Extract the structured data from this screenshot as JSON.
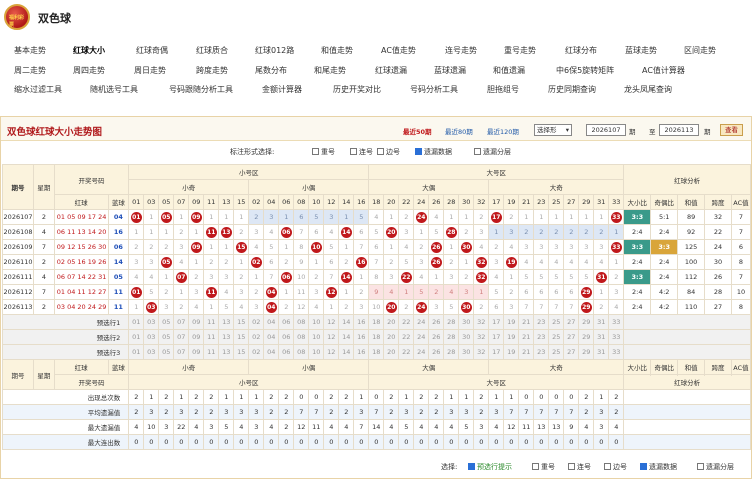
{
  "app": {
    "title": "双色球",
    "logo_text": "福利彩票"
  },
  "nav": [
    [
      "基本走势",
      "红球大小",
      "红球奇偶",
      "红球质合",
      "红球012路",
      "和值走势",
      "AC值走势",
      "连号走势",
      "重号走势",
      "红球分布",
      "蓝球走势",
      "区间走势"
    ],
    [
      "周二走势",
      "周四走势",
      "周日走势",
      "跨度走势",
      "尾数分布",
      "和尾走势",
      "红球遗漏",
      "蓝球遗漏",
      "和值遗漏",
      "中6保5旋转矩阵",
      "AC值计算器"
    ],
    [
      "缩水过滤工具",
      "随机选号工具",
      "号码跟随分析工具",
      "金额计算器",
      "历史开奖对比",
      "号码分析工具",
      "胆拖组号",
      "历史同期查询",
      "龙头凤尾查询"
    ]
  ],
  "nav_active": "红球大小",
  "panel": {
    "title": "双色球红球大小走势图",
    "p50": "最近50期",
    "p80": "最近80期",
    "p120": "最近120期",
    "select": "选择形",
    "from": "2026107",
    "to": "2026113",
    "lbl_qi": "期",
    "lbl_to": "至",
    "lbl_qi2": "期",
    "btn": "查看"
  },
  "options": {
    "label": "标注形式选择:",
    "items": [
      "重号",
      "连号",
      "边号",
      "遗漏数据",
      "遗漏分层"
    ]
  },
  "header": {
    "qihao": "期号",
    "xingqi": "星期",
    "kjhm": "开奖号码",
    "hongqiu": "红球",
    "lanqiu": "蓝球",
    "small_zone": "小号区",
    "big_zone": "大号区",
    "xiaoqi": "小奇",
    "xiaoou": "小偶",
    "daou": "大偶",
    "daqi": "大奇",
    "analysis": "红球分析",
    "dxb": "大小比",
    "job": "奇偶比",
    "hz": "和值",
    "kd": "跨度",
    "ac": "AC值"
  },
  "cols": [
    "01",
    "03",
    "05",
    "07",
    "09",
    "11",
    "13",
    "15",
    "02",
    "04",
    "06",
    "08",
    "10",
    "12",
    "14",
    "16",
    "18",
    "20",
    "22",
    "24",
    "26",
    "28",
    "30",
    "32",
    "17",
    "19",
    "21",
    "23",
    "25",
    "27",
    "29",
    "31",
    "33"
  ],
  "rows": [
    {
      "p": "2026107",
      "w": "2",
      "r": "01 05 09 17 24 33",
      "b": "04",
      "c": [
        "●",
        "1",
        "●",
        "1",
        "●",
        "1",
        "1",
        "1",
        "2",
        "3",
        "1",
        "6",
        "5",
        "3",
        "1",
        "5",
        "4",
        "1",
        "2",
        "●",
        "4",
        "1",
        "1",
        "2",
        "●",
        "2",
        "1",
        "1",
        "1",
        "1",
        "1",
        "1",
        "●"
      ],
      "dx": "3:3",
      "jo": "5:1",
      "hz": "89",
      "kd": "32",
      "ac": "7"
    },
    {
      "p": "2026108",
      "w": "4",
      "r": "06 11 13 14 20 28",
      "b": "16",
      "c": [
        "1",
        "1",
        "1",
        "2",
        "1",
        "●",
        "●",
        "2",
        "3",
        "4",
        "●",
        "7",
        "6",
        "4",
        "●",
        "6",
        "5",
        "●",
        "3",
        "1",
        "5",
        "●",
        "2",
        "3",
        "1",
        "3",
        "2",
        "2",
        "2",
        "2",
        "2",
        "2",
        "1"
      ],
      "dx": "2:4",
      "jo": "2:4",
      "hz": "92",
      "kd": "22",
      "ac": "7"
    },
    {
      "p": "2026109",
      "w": "7",
      "r": "09 12 15 26 30 33",
      "b": "06",
      "c": [
        "2",
        "2",
        "2",
        "3",
        "●",
        "1",
        "1",
        "●",
        "4",
        "5",
        "1",
        "8",
        "●",
        "5",
        "1",
        "7",
        "6",
        "1",
        "4",
        "2",
        "●",
        "1",
        "●",
        "4",
        "2",
        "4",
        "3",
        "3",
        "3",
        "3",
        "3",
        "3",
        "●"
      ],
      "dx": "3:3",
      "jo": "3:3",
      "hz": "125",
      "kd": "24",
      "ac": "6"
    },
    {
      "p": "2026110",
      "w": "2",
      "r": "02 05 16 19 26 32",
      "b": "14",
      "c": [
        "3",
        "3",
        "●",
        "4",
        "1",
        "2",
        "2",
        "1",
        "●",
        "6",
        "2",
        "9",
        "1",
        "6",
        "2",
        "●",
        "7",
        "2",
        "5",
        "3",
        "●",
        "2",
        "1",
        "●",
        "3",
        "●",
        "4",
        "4",
        "4",
        "4",
        "4",
        "4",
        "1"
      ],
      "dx": "2:4",
      "jo": "2:4",
      "hz": "100",
      "kd": "30",
      "ac": "8"
    },
    {
      "p": "2026111",
      "w": "4",
      "r": "06 07 14 22 31 32",
      "b": "05",
      "c": [
        "4",
        "4",
        "1",
        "●",
        "2",
        "3",
        "3",
        "2",
        "1",
        "7",
        "●",
        "10",
        "2",
        "7",
        "●",
        "1",
        "8",
        "3",
        "●",
        "4",
        "1",
        "3",
        "2",
        "●",
        "4",
        "1",
        "5",
        "5",
        "5",
        "5",
        "5",
        "●",
        "2"
      ],
      "dx": "3:3",
      "jo": "2:4",
      "hz": "112",
      "kd": "26",
      "ac": "7"
    },
    {
      "p": "2026112",
      "w": "7",
      "r": "01 04 11 12 27 29",
      "b": "11",
      "c": [
        "●",
        "5",
        "2",
        "1",
        "3",
        "●",
        "4",
        "3",
        "2",
        "●",
        "1",
        "11",
        "3",
        "●",
        "1",
        "2",
        "9",
        "4",
        "1",
        "5",
        "2",
        "4",
        "3",
        "1",
        "5",
        "2",
        "6",
        "6",
        "6",
        "6",
        "●",
        "1",
        "3"
      ],
      "dx": "2:4",
      "jo": "4:2",
      "hz": "84",
      "kd": "28",
      "ac": "10"
    },
    {
      "p": "2026113",
      "w": "2",
      "r": "03 04 20 24 29 30",
      "b": "11",
      "c": [
        "1",
        "●",
        "3",
        "2",
        "4",
        "1",
        "5",
        "4",
        "3",
        "●",
        "2",
        "12",
        "4",
        "1",
        "2",
        "3",
        "10",
        "●",
        "2",
        "●",
        "3",
        "5",
        "●",
        "2",
        "6",
        "3",
        "7",
        "7",
        "7",
        "7",
        "●",
        "2",
        "4"
      ],
      "dx": "2:4",
      "jo": "4:2",
      "hz": "110",
      "kd": "27",
      "ac": "8"
    }
  ],
  "prelabels": [
    "预选行1",
    "预选行2",
    "预选行3"
  ],
  "footer_hdr": {
    "qihao": "期号",
    "xingqi": "星期",
    "kjhm": "开奖号码"
  },
  "stats": [
    {
      "label": "出现总次数",
      "v": [
        "2",
        "1",
        "2",
        "1",
        "2",
        "2",
        "1",
        "1",
        "1",
        "2",
        "2",
        "0",
        "0",
        "2",
        "2",
        "1",
        "0",
        "2",
        "1",
        "2",
        "2",
        "1",
        "1",
        "2",
        "1",
        "1",
        "0",
        "0",
        "0",
        "0",
        "2",
        "1",
        "2"
      ]
    },
    {
      "label": "平均遗漏值",
      "v": [
        "2",
        "3",
        "2",
        "3",
        "2",
        "2",
        "3",
        "3",
        "3",
        "2",
        "2",
        "7",
        "7",
        "2",
        "2",
        "3",
        "7",
        "2",
        "3",
        "2",
        "2",
        "3",
        "3",
        "2",
        "3",
        "7",
        "7",
        "7",
        "7",
        "7",
        "2",
        "3",
        "2"
      ]
    },
    {
      "label": "最大遗漏值",
      "v": [
        "4",
        "10",
        "3",
        "22",
        "4",
        "3",
        "5",
        "4",
        "3",
        "4",
        "2",
        "12",
        "11",
        "4",
        "4",
        "7",
        "14",
        "4",
        "5",
        "4",
        "4",
        "4",
        "5",
        "3",
        "4",
        "12",
        "11",
        "13",
        "13",
        "9",
        "4",
        "3",
        "4"
      ]
    },
    {
      "label": "最大连出数",
      "v": [
        "0",
        "0",
        "0",
        "0",
        "0",
        "0",
        "0",
        "0",
        "0",
        "0",
        "0",
        "0",
        "0",
        "0",
        "0",
        "0",
        "0",
        "0",
        "0",
        "0",
        "0",
        "0",
        "0",
        "0",
        "0",
        "0",
        "0",
        "0",
        "0",
        "0",
        "0",
        "0",
        "0"
      ]
    }
  ],
  "bottom": {
    "label": "选择:",
    "items": [
      "预选行提示",
      "重号",
      "连号",
      "边号",
      "遗漏数据",
      "遗漏分层"
    ]
  }
}
